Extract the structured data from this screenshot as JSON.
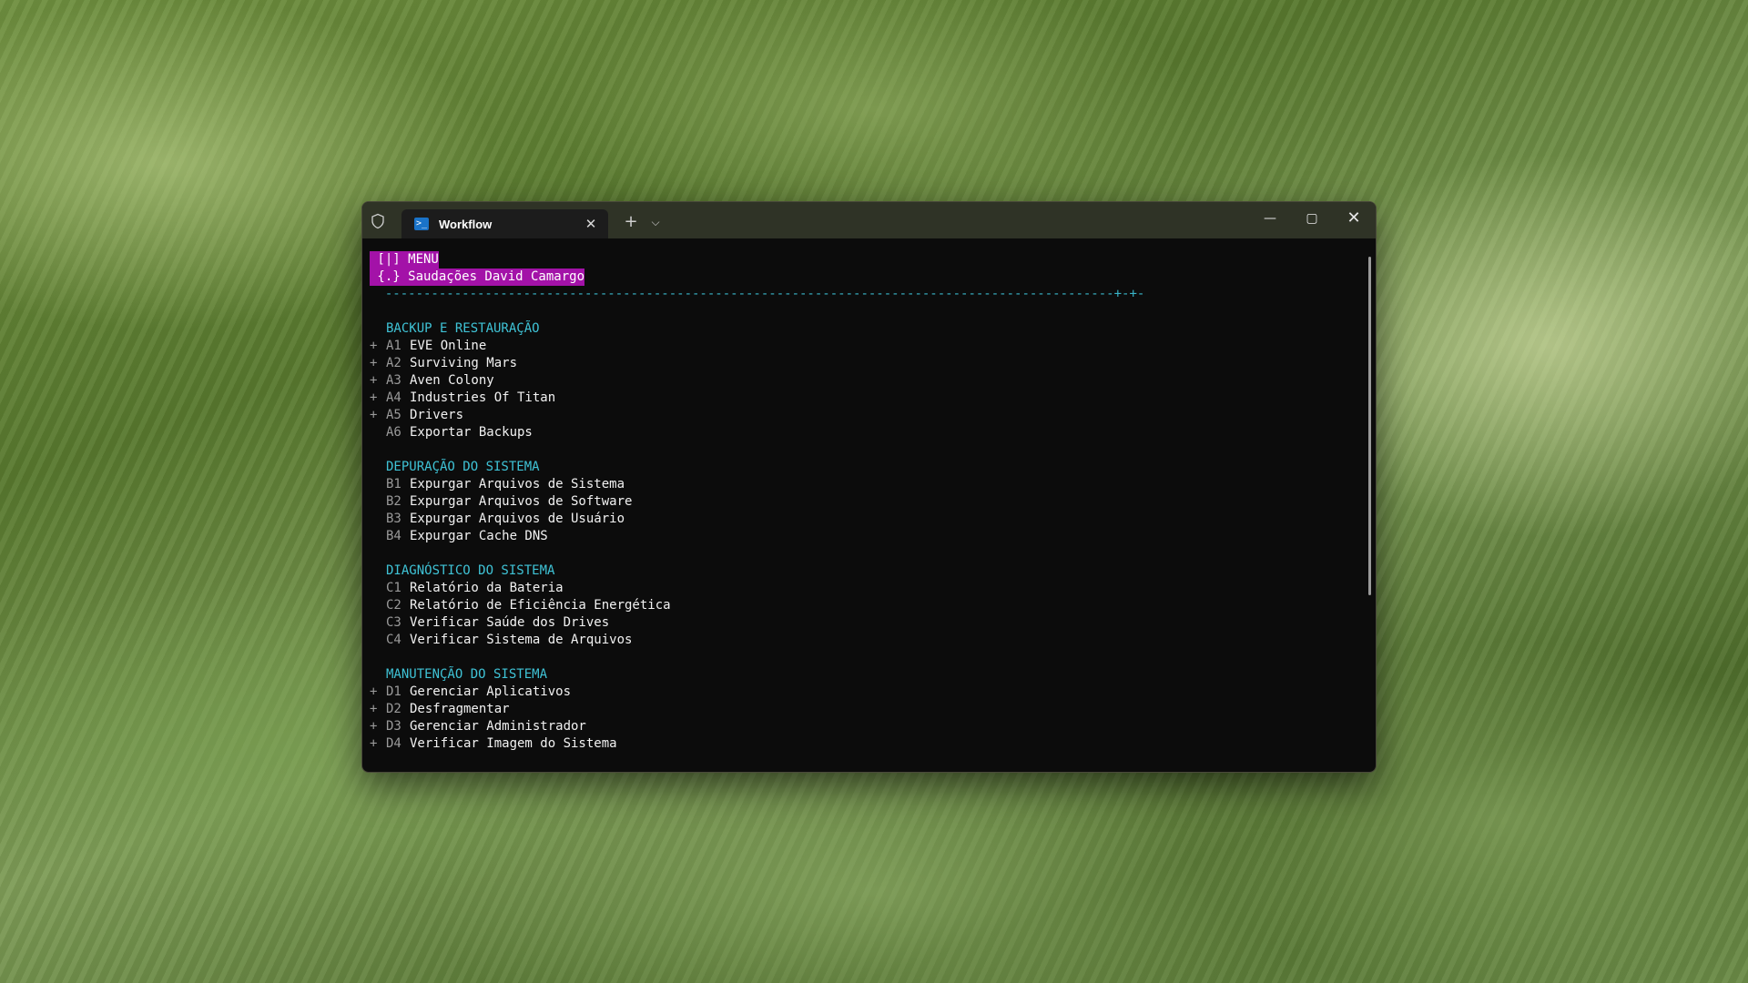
{
  "window": {
    "tab_title": "Workflow",
    "tab_icon_glyph": ">_",
    "new_tab_glyph": "+",
    "dropdown_glyph": "⌵",
    "minimize_glyph": "—",
    "maximize_glyph": "▢",
    "close_glyph": "✕",
    "tab_close_glyph": "✕"
  },
  "terminal": {
    "banner_menu": " [|] MENU",
    "banner_greeting": " {.} Saudações David Camargo",
    "divider": "  -----------------------------------------------------------------------------------------------+-+-",
    "sections": [
      {
        "title": "BACKUP E RESTAURAÇÃO",
        "items": [
          {
            "bullet": "+",
            "code": "A1",
            "label": "EVE Online"
          },
          {
            "bullet": "+",
            "code": "A2",
            "label": "Surviving Mars"
          },
          {
            "bullet": "+",
            "code": "A3",
            "label": "Aven Colony"
          },
          {
            "bullet": "+",
            "code": "A4",
            "label": "Industries Of Titan"
          },
          {
            "bullet": "+",
            "code": "A5",
            "label": "Drivers"
          },
          {
            "bullet": "",
            "code": "A6",
            "label": "Exportar Backups"
          }
        ]
      },
      {
        "title": "DEPURAÇÃO DO SISTEMA",
        "items": [
          {
            "bullet": "",
            "code": "B1",
            "label": "Expurgar Arquivos de Sistema"
          },
          {
            "bullet": "",
            "code": "B2",
            "label": "Expurgar Arquivos de Software"
          },
          {
            "bullet": "",
            "code": "B3",
            "label": "Expurgar Arquivos de Usuário"
          },
          {
            "bullet": "",
            "code": "B4",
            "label": "Expurgar Cache DNS"
          }
        ]
      },
      {
        "title": "DIAGNÓSTICO DO SISTEMA",
        "items": [
          {
            "bullet": "",
            "code": "C1",
            "label": "Relatório da Bateria"
          },
          {
            "bullet": "",
            "code": "C2",
            "label": "Relatório de Eficiência Energética"
          },
          {
            "bullet": "",
            "code": "C3",
            "label": "Verificar Saúde dos Drives"
          },
          {
            "bullet": "",
            "code": "C4",
            "label": "Verificar Sistema de Arquivos"
          }
        ]
      },
      {
        "title": "MANUTENÇÃO DO SISTEMA",
        "items": [
          {
            "bullet": "+",
            "code": "D1",
            "label": "Gerenciar Aplicativos"
          },
          {
            "bullet": "+",
            "code": "D2",
            "label": "Desfragmentar"
          },
          {
            "bullet": "+",
            "code": "D3",
            "label": "Gerenciar Administrador"
          },
          {
            "bullet": "+",
            "code": "D4",
            "label": "Verificar Imagem do Sistema"
          }
        ]
      }
    ]
  },
  "colors": {
    "banner_bg": "#a312a8",
    "section_title": "#3fc3d6",
    "divider": "#39b5c9",
    "terminal_bg": "#0c0c0c",
    "titlebar_bg": "#2f3326"
  }
}
